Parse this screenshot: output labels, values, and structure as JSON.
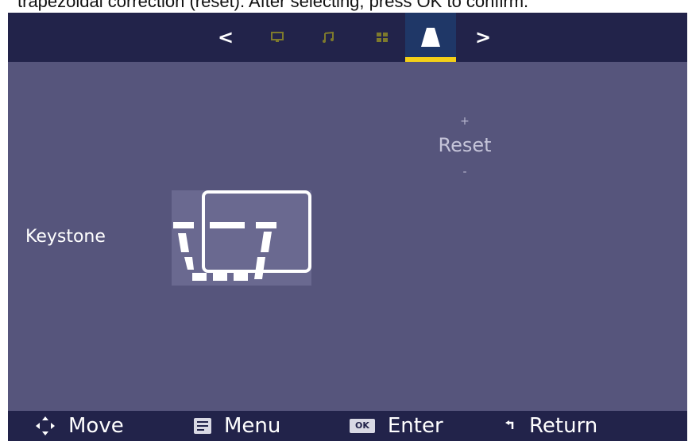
{
  "caption": "trapezoidal correction (reset). After selecting, press OK to confirm.",
  "topbar": {
    "prev_arrow": "<",
    "next_arrow": ">",
    "tabs": [
      {
        "icon": "monitor-icon",
        "active": false
      },
      {
        "icon": "music-icon",
        "active": false
      },
      {
        "icon": "grid-icon",
        "active": false
      },
      {
        "icon": "keystone-tab-icon",
        "active": true
      }
    ],
    "active_underline_color": "#f4d018"
  },
  "keystone": {
    "label": "Keystone",
    "reset_label": "Reset",
    "plus": "+",
    "minus": "-"
  },
  "footer": {
    "move": "Move",
    "menu": "Menu",
    "ok_badge": "OK",
    "enter": "Enter",
    "return": "Return"
  },
  "colors": {
    "screen_bg": "#56557c",
    "bar_bg": "#22234a",
    "accent": "#f4d018"
  }
}
